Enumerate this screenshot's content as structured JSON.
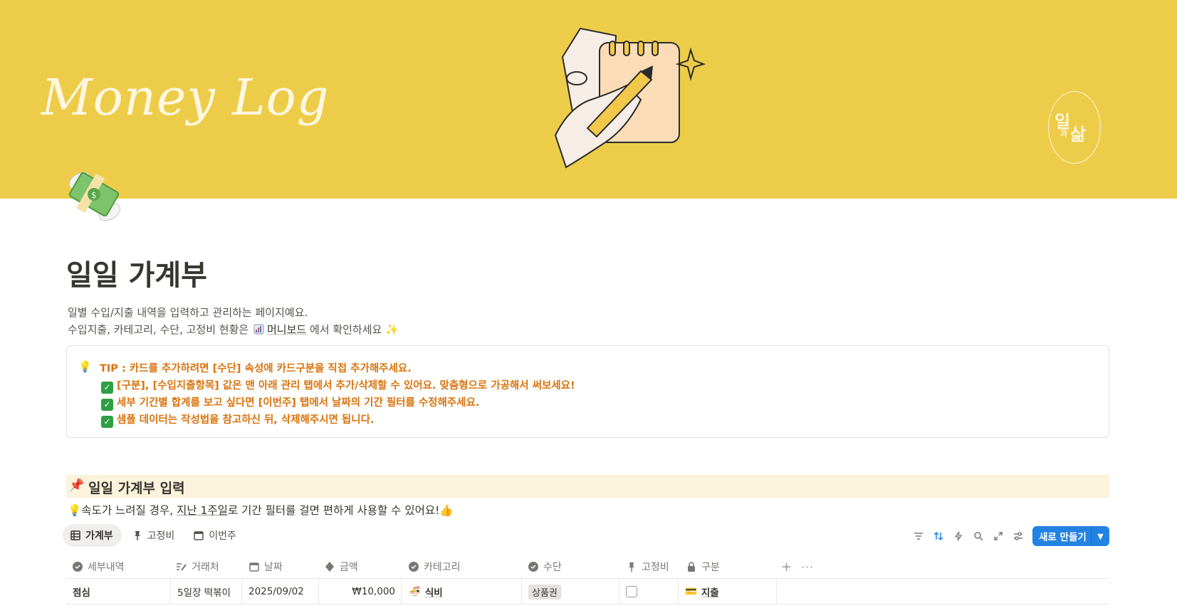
{
  "cover": {
    "title": "Money Log",
    "logo": {
      "l1": "일",
      "l2": "과",
      "l3": "삶"
    }
  },
  "page": {
    "title": "일일 가계부",
    "desc1": "일별 수입/지출 내역을 입력하고 관리하는 페이지예요.",
    "desc2_pre": "수입지출, 카테고리, 수단, 고정비 현황은",
    "desc2_link": "머니보드",
    "desc2_post": "에서 확인하세요 ✨"
  },
  "callout": {
    "tip": "TIP : 카드를 추가하려면 [수단] 속성에 카드구분을 직접 추가해주세요.",
    "items": [
      "[구분], [수입지출항목] 값은 맨 아래 관리 탭에서 추가/삭제할 수 있어요. 맞춤형으로 가공해서 써보세요!",
      "세부 기간별 합계를 보고 싶다면 [이번주] 탭에서 날짜의 기간 필터를 수정해주세요.",
      "샘플 데이터는 작성법을 참고하신 뒤, 삭제해주시면 됩니다."
    ]
  },
  "section": {
    "title": "일일 가계부 입력",
    "hint_pre": "💡속도가 느려질 경우,",
    "hint_link": "지난 1주일",
    "hint_post": "로 기간 필터를 걸면 편하게 사용할 수 있어요!👍"
  },
  "tabs": [
    {
      "label": "가계부"
    },
    {
      "label": "고정비"
    },
    {
      "label": "이번주"
    }
  ],
  "new_button": {
    "label": "새로 만들기"
  },
  "table": {
    "columns": [
      "세부내역",
      "거래처",
      "날짜",
      "금액",
      "카테고리",
      "수단",
      "고정비",
      "구분"
    ],
    "rows": [
      {
        "detail": "점심",
        "vendor": "5일장 떡볶이",
        "date": "2025/09/02",
        "amount": "₩10,000",
        "category": "식비",
        "method": "상품권",
        "fixed": false,
        "type": "지출"
      }
    ]
  },
  "colors": {
    "cover": "#edcc4a",
    "accent": "#2383e2",
    "callout_text": "#d9730d",
    "section_bg": "#fbf3db"
  }
}
